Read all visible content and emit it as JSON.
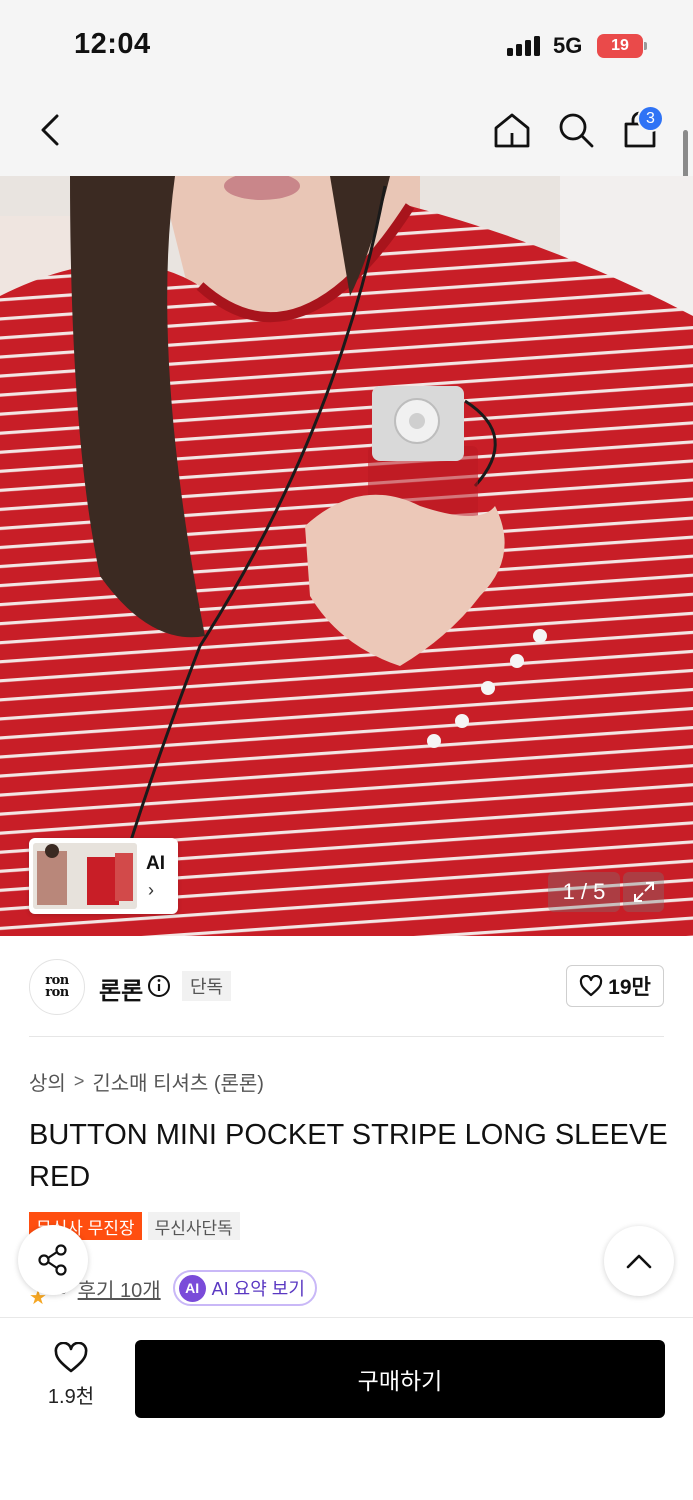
{
  "status_bar": {
    "time": "12:04",
    "network": "5G",
    "battery": "19"
  },
  "header": {
    "cart_count": "3"
  },
  "gallery": {
    "counter": "1 / 5",
    "ai_label": "AI",
    "ai_chevron": "›"
  },
  "brand": {
    "logo_text_line1": "ron",
    "logo_text_line2": "ron",
    "name": "론론",
    "exclusive_badge": "단독",
    "likes": "19만"
  },
  "product": {
    "breadcrumb": [
      "상의",
      "긴소매 티셔츠 (론론)"
    ],
    "breadcrumb_sep": ">",
    "title": "BUTTON MINI POCKET STRIPE LONG SLEEVE RED",
    "tags": [
      "무신사 무진장",
      "무신사단독"
    ],
    "rating": ".6",
    "review_link": "후기 10개",
    "ai_chip": "AI",
    "ai_summary": "AI 요약 보기"
  },
  "bottom_bar": {
    "wish_count": "1.9천",
    "buy_label": "구매하기"
  },
  "colors": {
    "accent_blue": "#2f73f5",
    "tag_orange": "#ff4e10",
    "shirt_red": "#c41d26",
    "ai_purple": "#7a4bd9"
  }
}
